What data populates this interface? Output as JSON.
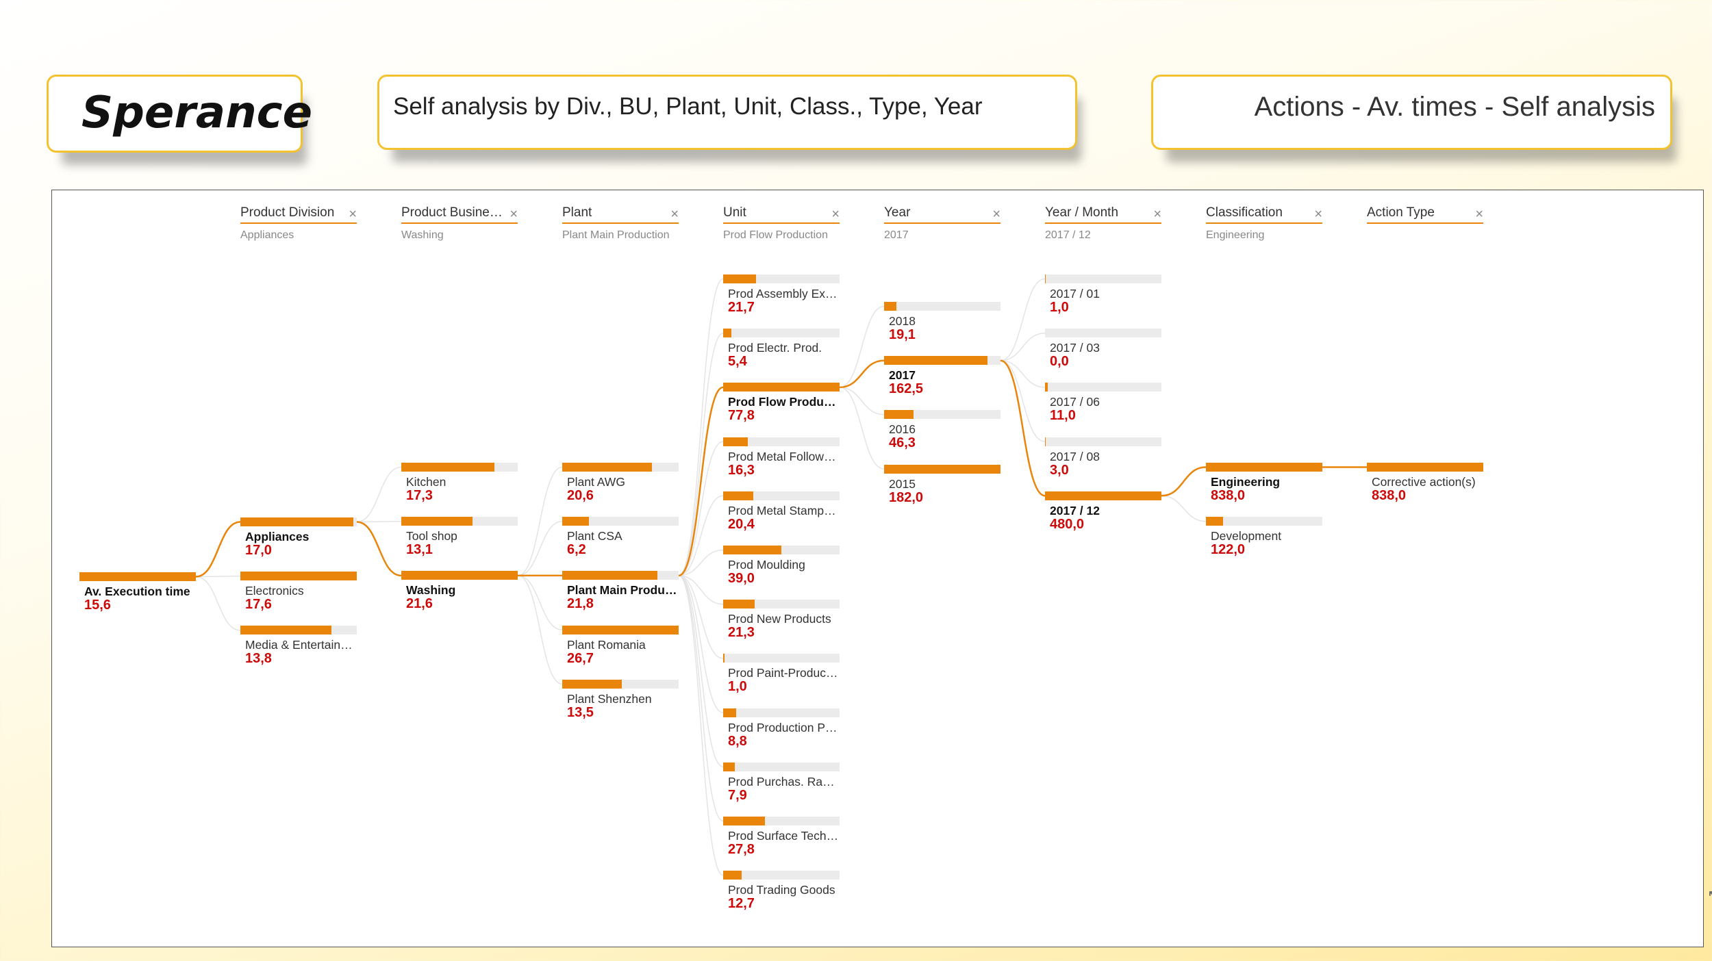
{
  "logo": {
    "text": "Sperance"
  },
  "subtitle": "Self analysis by Div., BU, Plant, Unit, Class., Type, Year",
  "action_title": "Actions - Av. times - Self analysis",
  "colors": {
    "accent": "#e8850a",
    "value": "#cc0a0a",
    "track": "#ebebeb",
    "card_border": "#f2c230"
  },
  "filters": [
    {
      "label": "Product Division",
      "value": "Appliances"
    },
    {
      "label": "Product Busine…",
      "value": "Washing"
    },
    {
      "label": "Plant",
      "value": "Plant Main Production"
    },
    {
      "label": "Unit",
      "value": "Prod Flow Production"
    },
    {
      "label": "Year",
      "value": "2017"
    },
    {
      "label": "Year / Month",
      "value": "2017 / 12"
    },
    {
      "label": "Classification",
      "value": "Engineering"
    },
    {
      "label": "Action Type",
      "value": ""
    }
  ],
  "close_glyph": "×",
  "tree": {
    "root": {
      "label": "Av. Execution time",
      "value": "15,6",
      "fraction": 1.0
    },
    "levels": [
      {
        "selected": 0,
        "nodes": [
          {
            "label": "Appliances",
            "value": "17,0",
            "fraction": 0.97
          },
          {
            "label": "Electronics",
            "value": "17,6",
            "fraction": 1.0
          },
          {
            "label": "Media & Entertain…",
            "value": "13,8",
            "fraction": 0.78
          }
        ]
      },
      {
        "selected": 2,
        "nodes": [
          {
            "label": "Kitchen",
            "value": "17,3",
            "fraction": 0.8
          },
          {
            "label": "Tool shop",
            "value": "13,1",
            "fraction": 0.61
          },
          {
            "label": "Washing",
            "value": "21,6",
            "fraction": 1.0
          }
        ]
      },
      {
        "selected": 2,
        "nodes": [
          {
            "label": "Plant AWG",
            "value": "20,6",
            "fraction": 0.77
          },
          {
            "label": "Plant CSA",
            "value": "6,2",
            "fraction": 0.23
          },
          {
            "label": "Plant Main Produc…",
            "value": "21,8",
            "fraction": 0.82
          },
          {
            "label": "Plant Romania",
            "value": "26,7",
            "fraction": 1.0
          },
          {
            "label": "Plant Shenzhen",
            "value": "13,5",
            "fraction": 0.51
          }
        ]
      },
      {
        "selected": 2,
        "nodes": [
          {
            "label": "Prod Assembly Ex…",
            "value": "21,7",
            "fraction": 0.28
          },
          {
            "label": "Prod Electr. Prod.",
            "value": "5,4",
            "fraction": 0.07
          },
          {
            "label": "Prod Flow Produc…",
            "value": "77,8",
            "fraction": 1.0
          },
          {
            "label": "Prod Metal Follow-On",
            "value": "16,3",
            "fraction": 0.21
          },
          {
            "label": "Prod Metal Stamp-…",
            "value": "20,4",
            "fraction": 0.26
          },
          {
            "label": "Prod Moulding",
            "value": "39,0",
            "fraction": 0.5
          },
          {
            "label": "Prod New Products",
            "value": "21,3",
            "fraction": 0.27
          },
          {
            "label": "Prod Paint-Producti…",
            "value": "1,0",
            "fraction": 0.013
          },
          {
            "label": "Prod Production Pr…",
            "value": "8,8",
            "fraction": 0.11
          },
          {
            "label": "Prod Purchas. Raw…",
            "value": "7,9",
            "fraction": 0.1
          },
          {
            "label": "Prod Surface Tech…",
            "value": "27,8",
            "fraction": 0.36
          },
          {
            "label": "Prod Trading Goods",
            "value": "12,7",
            "fraction": 0.16
          }
        ]
      },
      {
        "selected": 1,
        "nodes": [
          {
            "label": "2018",
            "value": "19,1",
            "fraction": 0.105
          },
          {
            "label": "2017",
            "value": "162,5",
            "fraction": 0.89
          },
          {
            "label": "2016",
            "value": "46,3",
            "fraction": 0.25
          },
          {
            "label": "2015",
            "value": "182,0",
            "fraction": 1.0
          }
        ]
      },
      {
        "selected": 4,
        "nodes": [
          {
            "label": "2017 / 01",
            "value": "1,0",
            "fraction": 0.002
          },
          {
            "label": "2017 / 03",
            "value": "0,0",
            "fraction": 0.0
          },
          {
            "label": "2017 / 06",
            "value": "11,0",
            "fraction": 0.023
          },
          {
            "label": "2017 / 08",
            "value": "3,0",
            "fraction": 0.006
          },
          {
            "label": "2017 / 12",
            "value": "480,0",
            "fraction": 1.0
          }
        ]
      },
      {
        "selected": 0,
        "nodes": [
          {
            "label": "Engineering",
            "value": "838,0",
            "fraction": 1.0
          },
          {
            "label": "Development",
            "value": "122,0",
            "fraction": 0.146
          }
        ]
      },
      {
        "selected": -1,
        "nodes": [
          {
            "label": "Corrective action(s)",
            "value": "838,0",
            "fraction": 1.0
          }
        ]
      }
    ]
  },
  "cursor_glyph": "↖"
}
